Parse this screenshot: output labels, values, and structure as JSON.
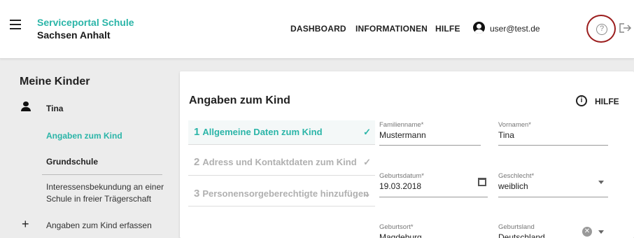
{
  "header": {
    "brand_line1": "Serviceportal Schule",
    "brand_line2": "Sachsen Anhalt",
    "nav": [
      "DASHBOARD",
      "INFORMATIONEN",
      "HILFE"
    ],
    "user_email": "user@test.de",
    "help_glyph": "?"
  },
  "sidebar": {
    "title": "Meine Kinder",
    "child_name": "Tina",
    "active_link": "Angaben zum Kind",
    "link_school": "Grundschule",
    "interest_text": "Interessensbekundung an einer Schule in freier Trägerschaft",
    "add_label": "Angaben zum Kind erfassen",
    "plus_glyph": "+"
  },
  "main": {
    "title": "Angaben zum Kind",
    "help_label": "HILFE",
    "info_glyph": "i",
    "steps": [
      {
        "num": "1",
        "label": "Allgemeine Daten zum Kind",
        "mark": "✓"
      },
      {
        "num": "2",
        "label": "Adress und Kontaktdaten zum Kind",
        "mark": "✓"
      },
      {
        "num": "3",
        "label": "Personensorgeberechtigte hinzufügen",
        "mark": "⌄"
      }
    ],
    "fields": {
      "familienname": {
        "label": "Familienname*",
        "value": "Mustermann"
      },
      "vornamen": {
        "label": "Vornamen*",
        "value": "Tina"
      },
      "geburtsdatum": {
        "label": "Geburtsdatum*",
        "value": "19.03.2018"
      },
      "geschlecht": {
        "label": "Geschlecht*",
        "value": "weiblich"
      },
      "geburtsort": {
        "label": "Geburtsort*",
        "value": "Magdeburg"
      },
      "geburtsland": {
        "label": "Geburtsland",
        "value": "Deutschland"
      }
    },
    "clear_glyph": "✕"
  },
  "colors": {
    "accent": "#2bb5a8",
    "highlight_ring": "#9b1d1d"
  },
  "icons": [
    "menu-icon",
    "user-icon",
    "help-circle-icon",
    "logout-icon",
    "person-icon",
    "plus-icon",
    "info-icon",
    "calendar-icon",
    "dropdown-caret-icon",
    "clear-icon",
    "check-icon"
  ]
}
